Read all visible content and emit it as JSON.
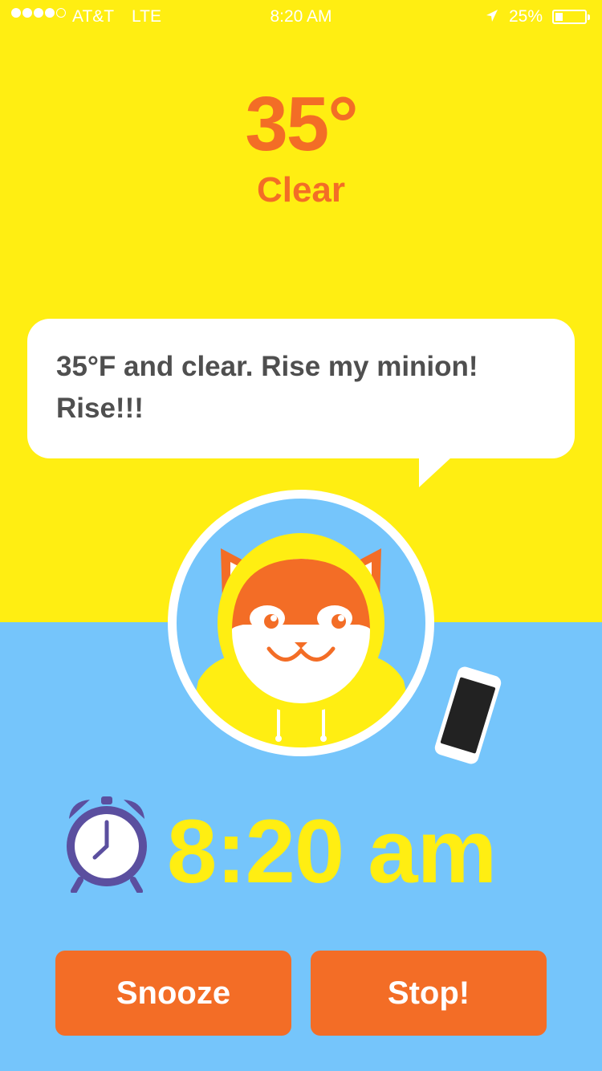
{
  "status_bar": {
    "carrier": "AT&T",
    "network": "LTE",
    "time": "8:20 AM",
    "battery_percent": "25%",
    "battery_level": 0.25,
    "signal_bars_filled": 4,
    "signal_bars_total": 5
  },
  "weather": {
    "temperature": "35°",
    "condition": "Clear"
  },
  "message": {
    "text": "35°F and clear. Rise my minion! Rise!!!"
  },
  "alarm": {
    "time": "8:20 am"
  },
  "buttons": {
    "snooze_label": "Snooze",
    "stop_label": "Stop!"
  },
  "colors": {
    "top_background": "#FFEE12",
    "bottom_background": "#75C5FB",
    "accent_orange": "#F36D26",
    "text_dark": "#4F4F4F",
    "alarm_time_yellow": "#FFEE12",
    "alarm_icon_purple": "#5B4F9F"
  },
  "icons": {
    "signal": "signal-dots-icon",
    "location": "location-arrow-icon",
    "battery": "battery-icon",
    "alarm": "alarm-clock-icon",
    "avatar": "cat-in-raincoat-avatar",
    "phone": "smartphone-illustration"
  }
}
